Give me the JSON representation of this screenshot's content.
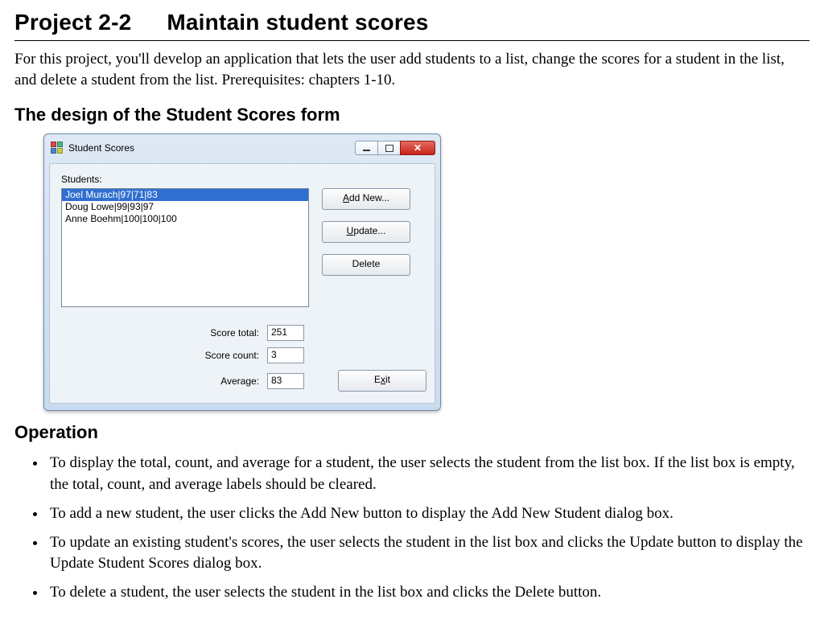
{
  "heading": {
    "project_code": "Project 2-2",
    "project_title": "Maintain student scores"
  },
  "intro": "For this project, you'll develop an application that lets the user add students to a list, change the scores for a student in the list, and delete a student from the list. Prerequisites: chapters 1-10.",
  "section_design": "The design of the Student Scores form",
  "window": {
    "title": "Student Scores",
    "students_label": "Students:",
    "list_items": [
      "Joel Murach|97|71|83",
      "Doug Lowe|99|93|97",
      "Anne Boehm|100|100|100"
    ],
    "selected_index": 0,
    "buttons": {
      "add_new": "Add New...",
      "update": "Update...",
      "delete": "Delete",
      "exit": "Exit"
    },
    "stats": {
      "score_total_label": "Score total:",
      "score_total_value": "251",
      "score_count_label": "Score count:",
      "score_count_value": "3",
      "average_label": "Average:",
      "average_value": "83"
    }
  },
  "section_operation": "Operation",
  "operation_items": [
    "To display the total, count, and average for a student, the user selects the student from the list box. If the list box is empty, the total, count, and average labels should be cleared.",
    "To add a new student, the user clicks the Add New button to display the Add New Student dialog box.",
    "To update an existing student's scores, the user selects the student in the list box and clicks the Update button to display the Update Student Scores dialog box.",
    "To delete a student, the user selects the student in the list box and clicks the Delete button."
  ]
}
